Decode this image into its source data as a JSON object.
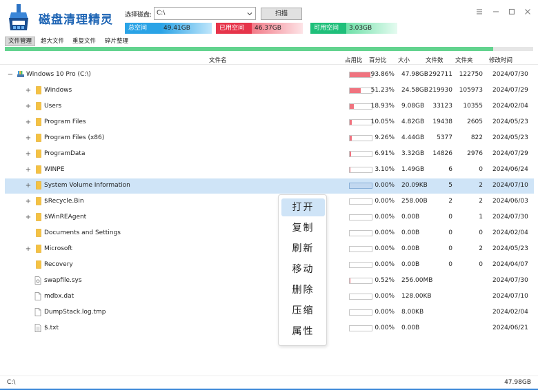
{
  "app": {
    "title": "磁盘清理精灵"
  },
  "toolbar": {
    "disk_label": "选择磁盘:",
    "disk_value": "C:\\",
    "scan_label": "扫描"
  },
  "stats": {
    "total": {
      "label": "总空间",
      "value": "49.41GB",
      "color": "#2aa3e6"
    },
    "used": {
      "label": "已用空间",
      "value": "46.37GB",
      "color": "#e6344a"
    },
    "free": {
      "label": "可用空间",
      "value": "3.03GB",
      "color": "#1fbf7a"
    }
  },
  "menu": {
    "items": [
      "文件管理",
      "超大文件",
      "重复文件",
      "碎片整理"
    ],
    "active": 0
  },
  "progress": {
    "fraction": 0.924
  },
  "columns": [
    "文件名",
    "占用比",
    "百分比",
    "大小",
    "文件数",
    "文件夹",
    "修改时间"
  ],
  "rows": [
    {
      "name": "Windows 10 Pro (C:\\)",
      "type": "drive",
      "expand": "−",
      "ratio": 0.9386,
      "pct": "93.86%",
      "size": "47.98GB",
      "files": "292711",
      "folders": "122750",
      "date": "2024/07/30"
    },
    {
      "name": "Windows",
      "type": "folder",
      "expand": "+",
      "ratio": 0.5123,
      "pct": "51.23%",
      "size": "24.58GB",
      "files": "219930",
      "folders": "105973",
      "date": "2024/07/29"
    },
    {
      "name": "Users",
      "type": "folder",
      "expand": "+",
      "ratio": 0.1893,
      "pct": "18.93%",
      "size": "9.08GB",
      "files": "33123",
      "folders": "10355",
      "date": "2024/02/04"
    },
    {
      "name": "Program Files",
      "type": "folder",
      "expand": "+",
      "ratio": 0.1005,
      "pct": "10.05%",
      "size": "4.82GB",
      "files": "19438",
      "folders": "2605",
      "date": "2024/05/23"
    },
    {
      "name": "Program Files (x86)",
      "type": "folder",
      "expand": "+",
      "ratio": 0.0926,
      "pct": "9.26%",
      "size": "4.44GB",
      "files": "5377",
      "folders": "822",
      "date": "2024/05/23"
    },
    {
      "name": "ProgramData",
      "type": "folder",
      "expand": "+",
      "ratio": 0.0691,
      "pct": "6.91%",
      "size": "3.32GB",
      "files": "14826",
      "folders": "2976",
      "date": "2024/07/29"
    },
    {
      "name": "WINPE",
      "type": "folder",
      "expand": "+",
      "ratio": 0.031,
      "pct": "3.10%",
      "size": "1.49GB",
      "files": "6",
      "folders": "0",
      "date": "2024/06/24"
    },
    {
      "name": "System Volume Information",
      "type": "folder",
      "expand": "+",
      "ratio": 0.0,
      "pct": "0.00%",
      "size": "20.09KB",
      "files": "5",
      "folders": "2",
      "date": "2024/07/10",
      "selected": true
    },
    {
      "name": "$Recycle.Bin",
      "type": "folder",
      "expand": "+",
      "ratio": 0.0,
      "pct": "0.00%",
      "size": "258.00B",
      "files": "2",
      "folders": "2",
      "date": "2024/06/03"
    },
    {
      "name": "$WinREAgent",
      "type": "folder",
      "expand": "+",
      "ratio": 0.0,
      "pct": "0.00%",
      "size": "0.00B",
      "files": "0",
      "folders": "1",
      "date": "2024/07/30"
    },
    {
      "name": "Documents and Settings",
      "type": "folder",
      "expand": "",
      "ratio": 0.0,
      "pct": "0.00%",
      "size": "0.00B",
      "files": "0",
      "folders": "0",
      "date": "2024/02/04"
    },
    {
      "name": "Microsoft",
      "type": "folder",
      "expand": "+",
      "ratio": 0.0,
      "pct": "0.00%",
      "size": "0.00B",
      "files": "0",
      "folders": "2",
      "date": "2024/05/23"
    },
    {
      "name": "Recovery",
      "type": "folder",
      "expand": "",
      "ratio": 0.0,
      "pct": "0.00%",
      "size": "0.00B",
      "files": "0",
      "folders": "0",
      "date": "2024/04/07"
    },
    {
      "name": "swapfile.sys",
      "type": "sysfile",
      "expand": "",
      "ratio": 0.0052,
      "pct": "0.52%",
      "size": "256.00MB",
      "files": "",
      "folders": "",
      "date": "2024/07/30"
    },
    {
      "name": "mdbx.dat",
      "type": "file",
      "expand": "",
      "ratio": 0.0,
      "pct": "0.00%",
      "size": "128.00KB",
      "files": "",
      "folders": "",
      "date": "2024/07/10"
    },
    {
      "name": "DumpStack.log.tmp",
      "type": "file",
      "expand": "",
      "ratio": 0.0,
      "pct": "0.00%",
      "size": "8.00KB",
      "files": "",
      "folders": "",
      "date": "2024/02/04"
    },
    {
      "name": "$.txt",
      "type": "textfile",
      "expand": "",
      "ratio": 0.0,
      "pct": "0.00%",
      "size": "0.00B",
      "files": "",
      "folders": "",
      "date": "2024/06/21"
    }
  ],
  "context_menu": {
    "items": [
      "打开",
      "复制",
      "刷新",
      "移动",
      "删除",
      "压缩",
      "属性"
    ],
    "hover": 0
  },
  "status": {
    "left": "C:\\",
    "right": "47.98GB"
  }
}
